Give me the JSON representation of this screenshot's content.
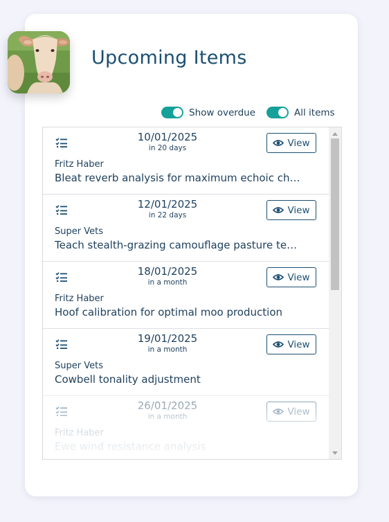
{
  "header": {
    "title": "Upcoming Items"
  },
  "toggles": {
    "show_overdue": {
      "label": "Show overdue",
      "on": true
    },
    "all_items": {
      "label": "All items",
      "on": true
    }
  },
  "colors": {
    "accent": "#16a09a",
    "text": "#1d3f5c",
    "title": "#1b4f72"
  },
  "items": [
    {
      "date": "10/01/2025",
      "relative": "in 20 days",
      "owner": "Fritz Haber",
      "title": "Bleat reverb analysis for maximum echoic ch…",
      "view_label": "View",
      "icon": "task-list-icon"
    },
    {
      "date": "12/01/2025",
      "relative": "in 22 days",
      "owner": "Super Vets",
      "title": "Teach stealth-grazing camouflage pasture te…",
      "view_label": "View",
      "icon": "task-list-icon"
    },
    {
      "date": "18/01/2025",
      "relative": "in a month",
      "owner": "Fritz Haber",
      "title": "Hoof calibration for optimal moo production",
      "view_label": "View",
      "icon": "task-list-icon"
    },
    {
      "date": "19/01/2025",
      "relative": "in a month",
      "owner": "Super Vets",
      "title": "Cowbell tonality adjustment",
      "view_label": "View",
      "icon": "task-list-icon"
    },
    {
      "date": "26/01/2025",
      "relative": "in a month",
      "owner": "Fritz Haber",
      "title": "Ewe wind resistance analysis",
      "view_label": "View",
      "icon": "task-list-icon"
    }
  ]
}
